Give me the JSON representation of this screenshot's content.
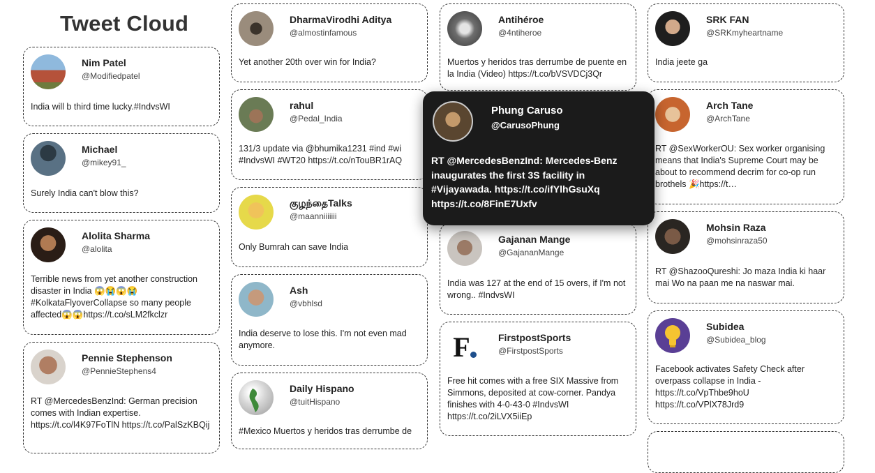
{
  "page": {
    "title": "Tweet Cloud"
  },
  "popup": {
    "name": "Phung Caruso",
    "handle": "@CarusoPhung",
    "text": "RT @MercedesBenzInd: Mercedes-Benz inaugurates the first 3S facility in #Vijayawada. https://t.co/ifYlhGsuXq https://t.co/8FinE7Uxfv",
    "avatar_icon": "person-photo-icon"
  },
  "tweets": [
    {
      "name": "Nim Patel",
      "handle": "@Modifiedpatel",
      "text": "India will b third time lucky.#IndvsWI",
      "avatar_icon": "red-rocks-photo-icon"
    },
    {
      "name": "Michael",
      "handle": "@mikey91_",
      "text": "Surely India can't blow this?",
      "avatar_icon": "person-photo-icon"
    },
    {
      "name": "Alolita Sharma",
      "handle": "@alolita",
      "text": "Terrible news from yet another construction disaster in India 😱😭😱😭 #KolkataFlyoverCollapse so many people affected😱😱https://t.co/sLM2fkclzr",
      "avatar_icon": "person-photo-icon"
    },
    {
      "name": "Pennie Stephenson",
      "handle": "@PennieStephens4",
      "text": "RT @MercedesBenzInd: German precision comes with Indian expertise. https://t.co/l4K97FoTlN https://t.co/PalSzKBQij",
      "avatar_icon": "person-photo-icon"
    },
    {
      "name": "DharmaVirodhi Aditya",
      "handle": "@almostinfamous",
      "text": "Yet another 20th over win for India?",
      "avatar_icon": "person-photo-icon"
    },
    {
      "name": "rahul",
      "handle": "@Pedal_India",
      "text": "131/3 update via @bhumika1231 #ind #wi #IndvsWI #WT20 https://t.co/nTouBR1rAQ",
      "avatar_icon": "cyclist-photo-icon"
    },
    {
      "name": "குழந்தைTalks",
      "handle": "@maanniiiiiii",
      "text": "Only Bumrah can save India",
      "avatar_icon": "cartoon-face-icon"
    },
    {
      "name": "Ash",
      "handle": "@vbhlsd",
      "text": "India deserve to lose this. I'm not even mad anymore.",
      "avatar_icon": "person-photo-icon"
    },
    {
      "name": "Daily Hispano",
      "handle": "@tuitHispano",
      "text": "#Mexico Muertos y heridos tras derrumbe de",
      "avatar_icon": "globe-icon"
    },
    {
      "name": "Antihéroe",
      "handle": "@4ntiheroe",
      "text": "Muertos y heridos tras derrumbe de puente en la India (Video) https://t.co/bVSVDCj3Qr",
      "avatar_icon": "headphones-photo-icon"
    },
    {
      "name": "Gajanan Mange",
      "handle": "@GajananMange",
      "text": "India was 127 at the end of 15 overs, if I'm not wrong.. #IndvsWI",
      "avatar_icon": "person-photo-icon"
    },
    {
      "name": "FirstpostSports",
      "handle": "@FirstpostSports",
      "text": "Free hit comes with a free SIX Massive from Simmons, deposited at cow-corner. Pandya finishes with 4-0-43-0 #IndvsWI https://t.co/2iLVX5iiEp",
      "avatar_icon": "firstpost-logo-icon",
      "logo_text": "F"
    },
    {
      "name": "SRK FAN",
      "handle": "@SRKmyheartname",
      "text": "India jeete ga",
      "avatar_icon": "person-photo-icon"
    },
    {
      "name": "Arch Tane",
      "handle": "@ArchTane",
      "text": "RT @SexWorkerOU: Sex worker organising means that India's Supreme Court may be about to recommend decrim for co-op run brothels 🎉https://t…",
      "avatar_icon": "cartoon-character-icon"
    },
    {
      "name": "Mohsin Raza",
      "handle": "@mohsinraza50",
      "text": "RT @ShazooQureshi: Jo maza India ki haar mai Wo na paan me na naswar mai.",
      "avatar_icon": "person-photo-icon"
    },
    {
      "name": "Subidea",
      "handle": "@Subidea_blog",
      "text": "Facebook activates Safety Check after overpass collapse in India - https://t.co/VpThbe9hoU https://t.co/VPlX78Jrd9",
      "avatar_icon": "lightbulb-icon"
    }
  ]
}
